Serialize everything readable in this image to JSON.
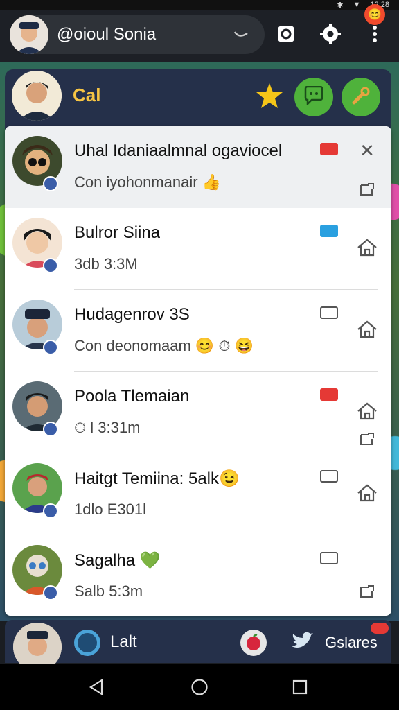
{
  "status_bar": {
    "time": "12:28"
  },
  "top_bar": {
    "search_title": "@oioul Sonia"
  },
  "group_header": {
    "name": "Cal"
  },
  "chats": [
    {
      "name": "Uhal Idaniaalmnal ogaviocel",
      "preview": "Con iyohonmanair 👍",
      "tag_color": "#e53935",
      "actions": [
        "close",
        "reply"
      ]
    },
    {
      "name": "Bulror Siina",
      "preview": "3db 3:3M",
      "tag_color": "#2aa0e0",
      "actions": [
        "home"
      ]
    },
    {
      "name": "Hudagenrov 3S",
      "preview": "Con deonomaam  😊 ⏱ 😆",
      "tag_color": "#555555",
      "actions": [
        "home"
      ]
    },
    {
      "name": "Poola  Tlemaian",
      "preview": "⏱ l   3:31m",
      "tag_color": "#e53935",
      "actions": [
        "home",
        "reply"
      ]
    },
    {
      "name": "Haitgt Temiina: 5alk😉",
      "preview": "1dlo E301l",
      "tag_color": "#555555",
      "actions": [
        "home"
      ]
    },
    {
      "name": "Sagalha 💚",
      "preview": "Salb  5:3m",
      "tag_color": "#555555",
      "actions": [
        "reply"
      ]
    }
  ],
  "bottom_bar": {
    "left_label": "Lalt",
    "right_label": "Gslares"
  },
  "colors": {
    "accent_yellow": "#f7c544",
    "fab_green": "#4fb23b",
    "header_navy": "#25304a"
  }
}
